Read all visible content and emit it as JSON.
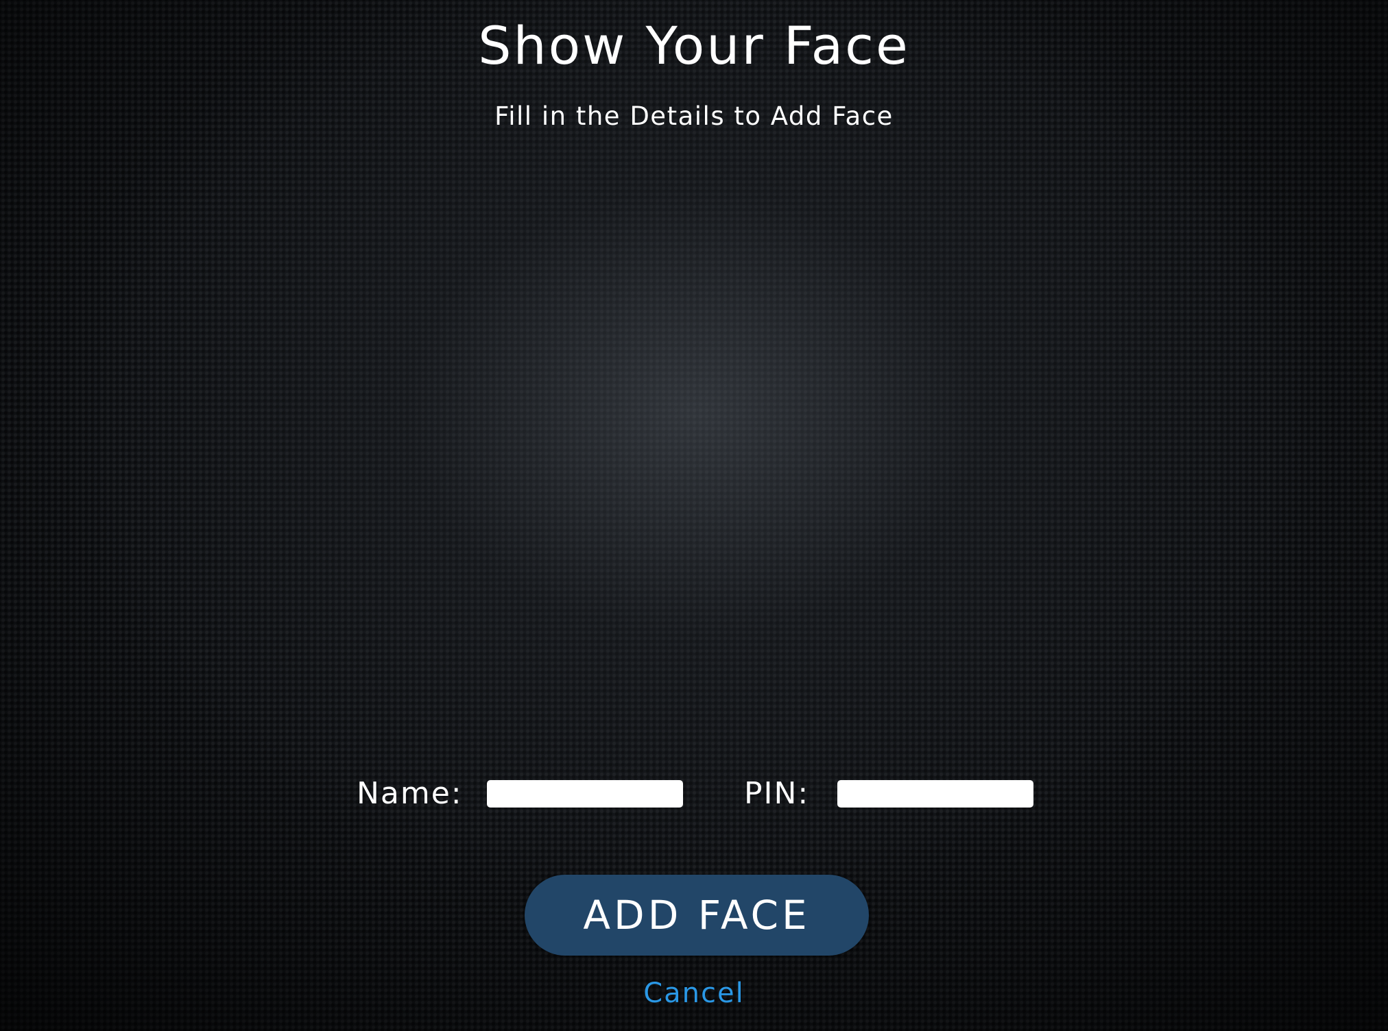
{
  "header": {
    "title": "Show Your Face",
    "subtitle": "Fill in the Details to Add Face"
  },
  "form": {
    "name_label": "Name:",
    "name_value": "",
    "pin_label": "PIN:",
    "pin_value": ""
  },
  "actions": {
    "add_face_label": "ADD FACE",
    "cancel_label": "Cancel"
  },
  "colors": {
    "background": "#101215",
    "button": "#224668",
    "link": "#2a98e6",
    "text": "#ffffff"
  }
}
